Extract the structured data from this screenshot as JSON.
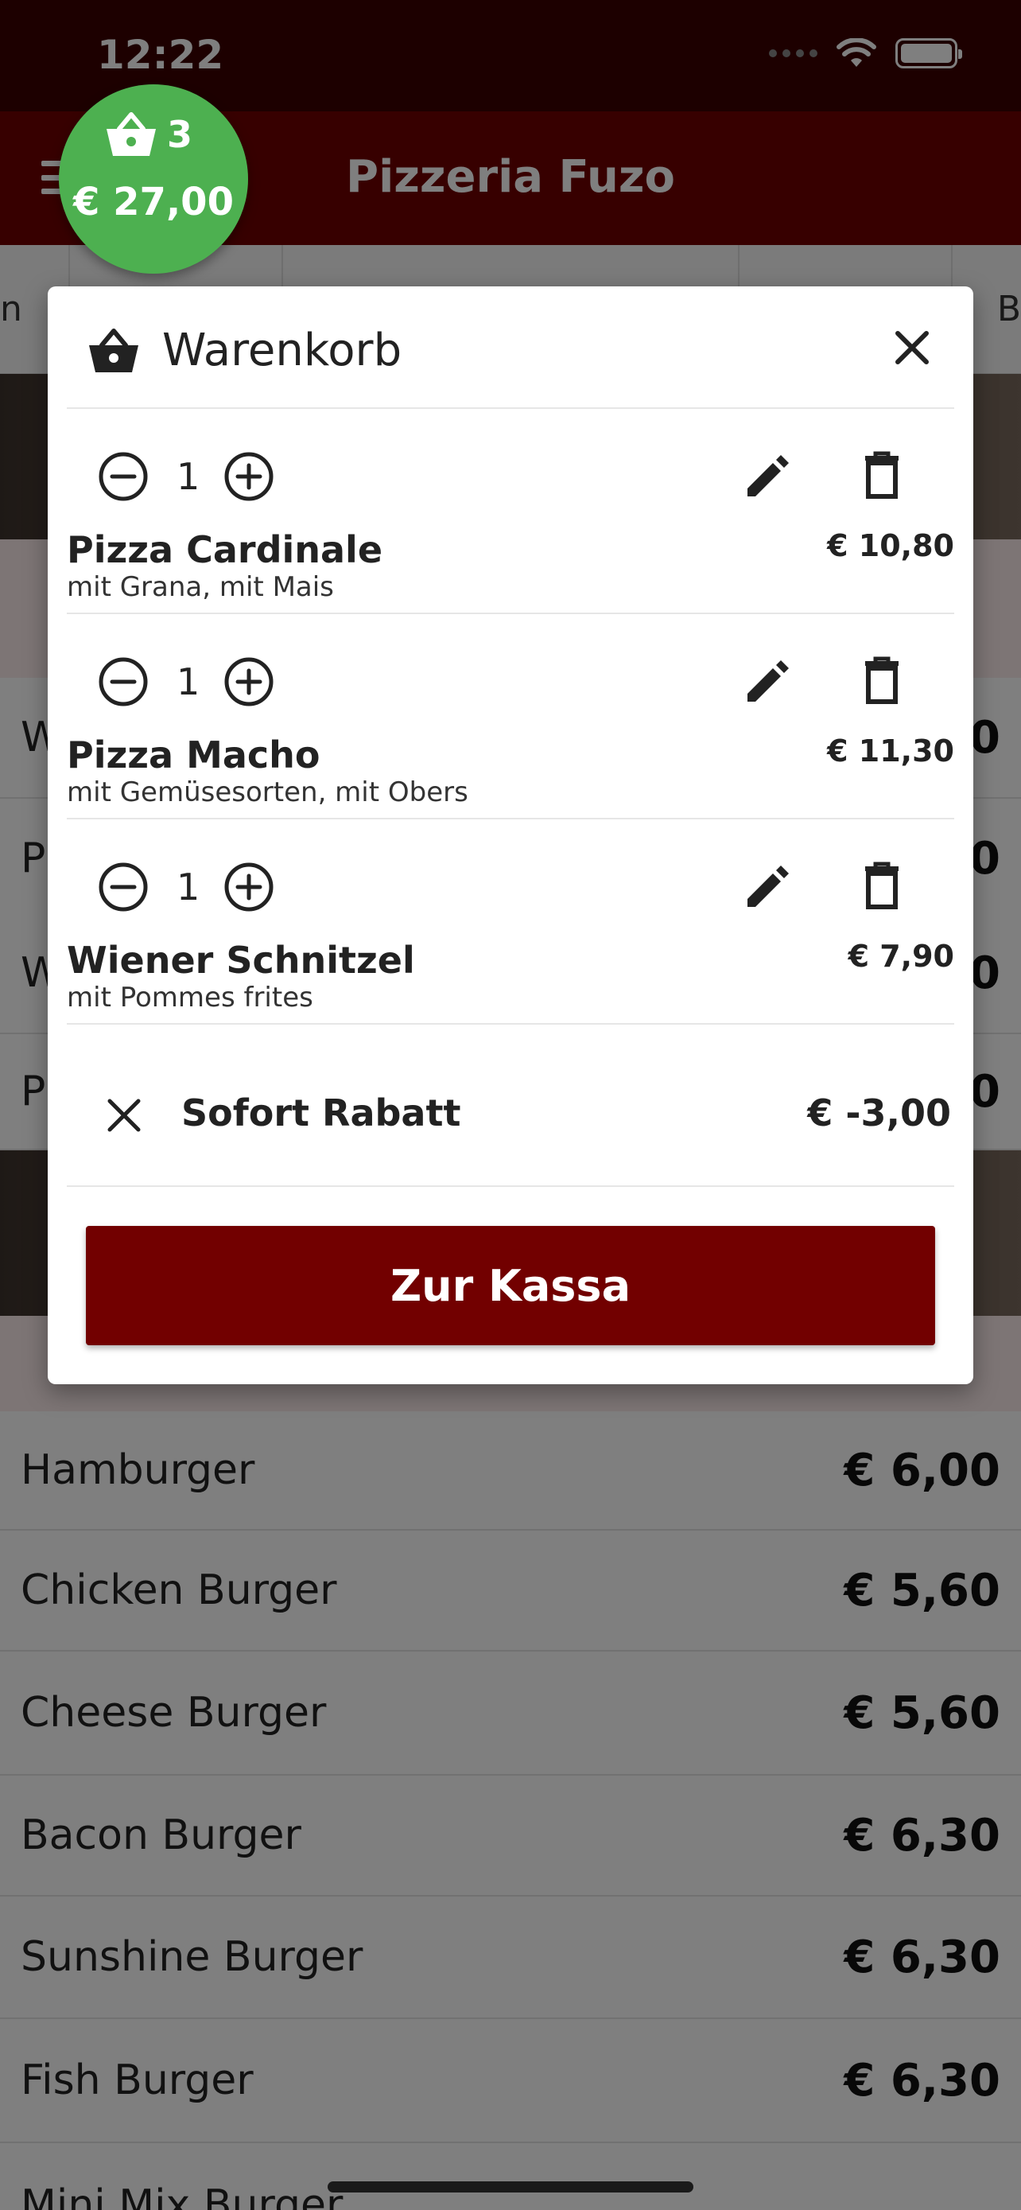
{
  "status_bar": {
    "time": "12:22"
  },
  "header": {
    "title": "Pizzeria Fuzo"
  },
  "cart_badge": {
    "count": "3",
    "total": "€ 27,00"
  },
  "category_tabs": [
    "n",
    "",
    "",
    "",
    "B"
  ],
  "background_rows": [
    {
      "name": "W",
      "price": "0"
    },
    {
      "name": "P",
      "price": "0"
    },
    {
      "name": "W",
      "price": "0"
    },
    {
      "name": "P",
      "price": "0"
    }
  ],
  "burger_menu": [
    {
      "name": "Hamburger",
      "price": "€ 6,00"
    },
    {
      "name": "Chicken Burger",
      "price": "€ 5,60"
    },
    {
      "name": "Cheese Burger",
      "price": "€ 5,60"
    },
    {
      "name": "Bacon Burger",
      "price": "€ 6,30"
    },
    {
      "name": "Sunshine Burger",
      "price": "€ 6,30"
    },
    {
      "name": "Fish Burger",
      "price": "€ 6,30"
    },
    {
      "name": "Mini Mix Burger",
      "price": ""
    }
  ],
  "cart_modal": {
    "title": "Warenkorb",
    "items": [
      {
        "qty": "1",
        "name": "Pizza Cardinale",
        "options": "mit Grana, mit Mais",
        "price": "€ 10,80"
      },
      {
        "qty": "1",
        "name": "Pizza Macho",
        "options": "mit Gemüsesorten, mit Obers",
        "price": "€ 11,30"
      },
      {
        "qty": "1",
        "name": "Wiener Schnitzel",
        "options": "mit Pommes frites",
        "price": "€ 7,90"
      }
    ],
    "discount": {
      "label": "Sofort Rabatt",
      "amount": "€ -3,00"
    },
    "checkout_label": "Zur Kassa"
  },
  "colors": {
    "header": "#6e0000",
    "status_bar": "#3a0000",
    "checkout": "#720000",
    "badge": "#4db050"
  }
}
